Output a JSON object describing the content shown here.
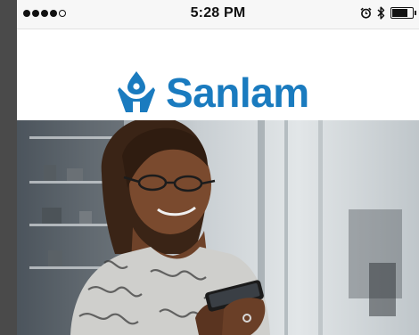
{
  "status_bar": {
    "signal_dots": [
      true,
      true,
      true,
      true,
      false
    ],
    "time": "5:28 PM",
    "icons": [
      "alarm-clock-icon",
      "bluetooth-icon",
      "battery-icon"
    ],
    "battery_level": 0.85
  },
  "brand": {
    "name": "Sanlam",
    "color": "#1a7bbf"
  },
  "hero": {
    "image": "woman-using-smartphone-in-office"
  }
}
